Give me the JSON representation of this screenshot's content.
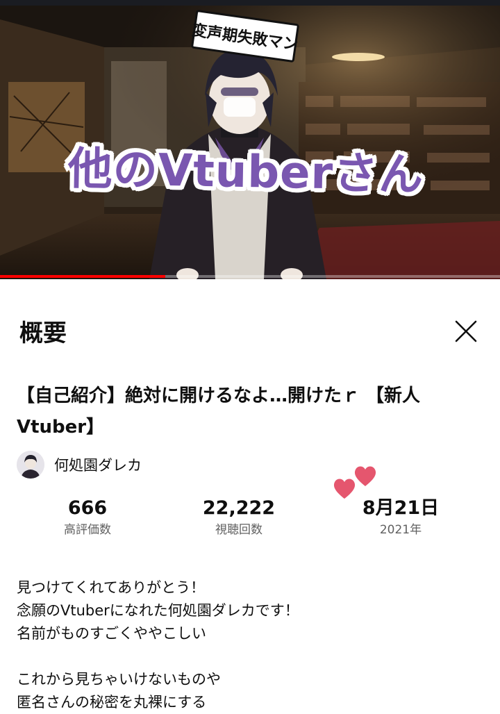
{
  "video": {
    "thumbnail_banner": "変声期失敗マン",
    "thumbnail_title": "他のVtuberさん",
    "progress_fraction": 0.33,
    "accent_color": "#ff0000",
    "title_color": "#7a57b0"
  },
  "sheet": {
    "title": "概要",
    "close_icon": "close-icon",
    "video_title": "【自己紹介】絶対に開けるなよ…開けたｒ 【新人Vtuber】",
    "channel": {
      "name": "何処園ダレカ",
      "avatar_icon": "avatar"
    },
    "stats": [
      {
        "value": "666",
        "label": "高評価数"
      },
      {
        "value": "22,222",
        "label": "視聴回数"
      },
      {
        "value": "8月21日",
        "label": "2021年"
      }
    ],
    "description": [
      "見つけてくれてありがとう！",
      "念願のVtuberになれた何処園ダレカです！",
      "名前がものすごくややこしい",
      "",
      "これから見ちゃいけないものや",
      "匿名さんの秘密を丸裸にする"
    ],
    "heart_color": "#e5566e"
  }
}
